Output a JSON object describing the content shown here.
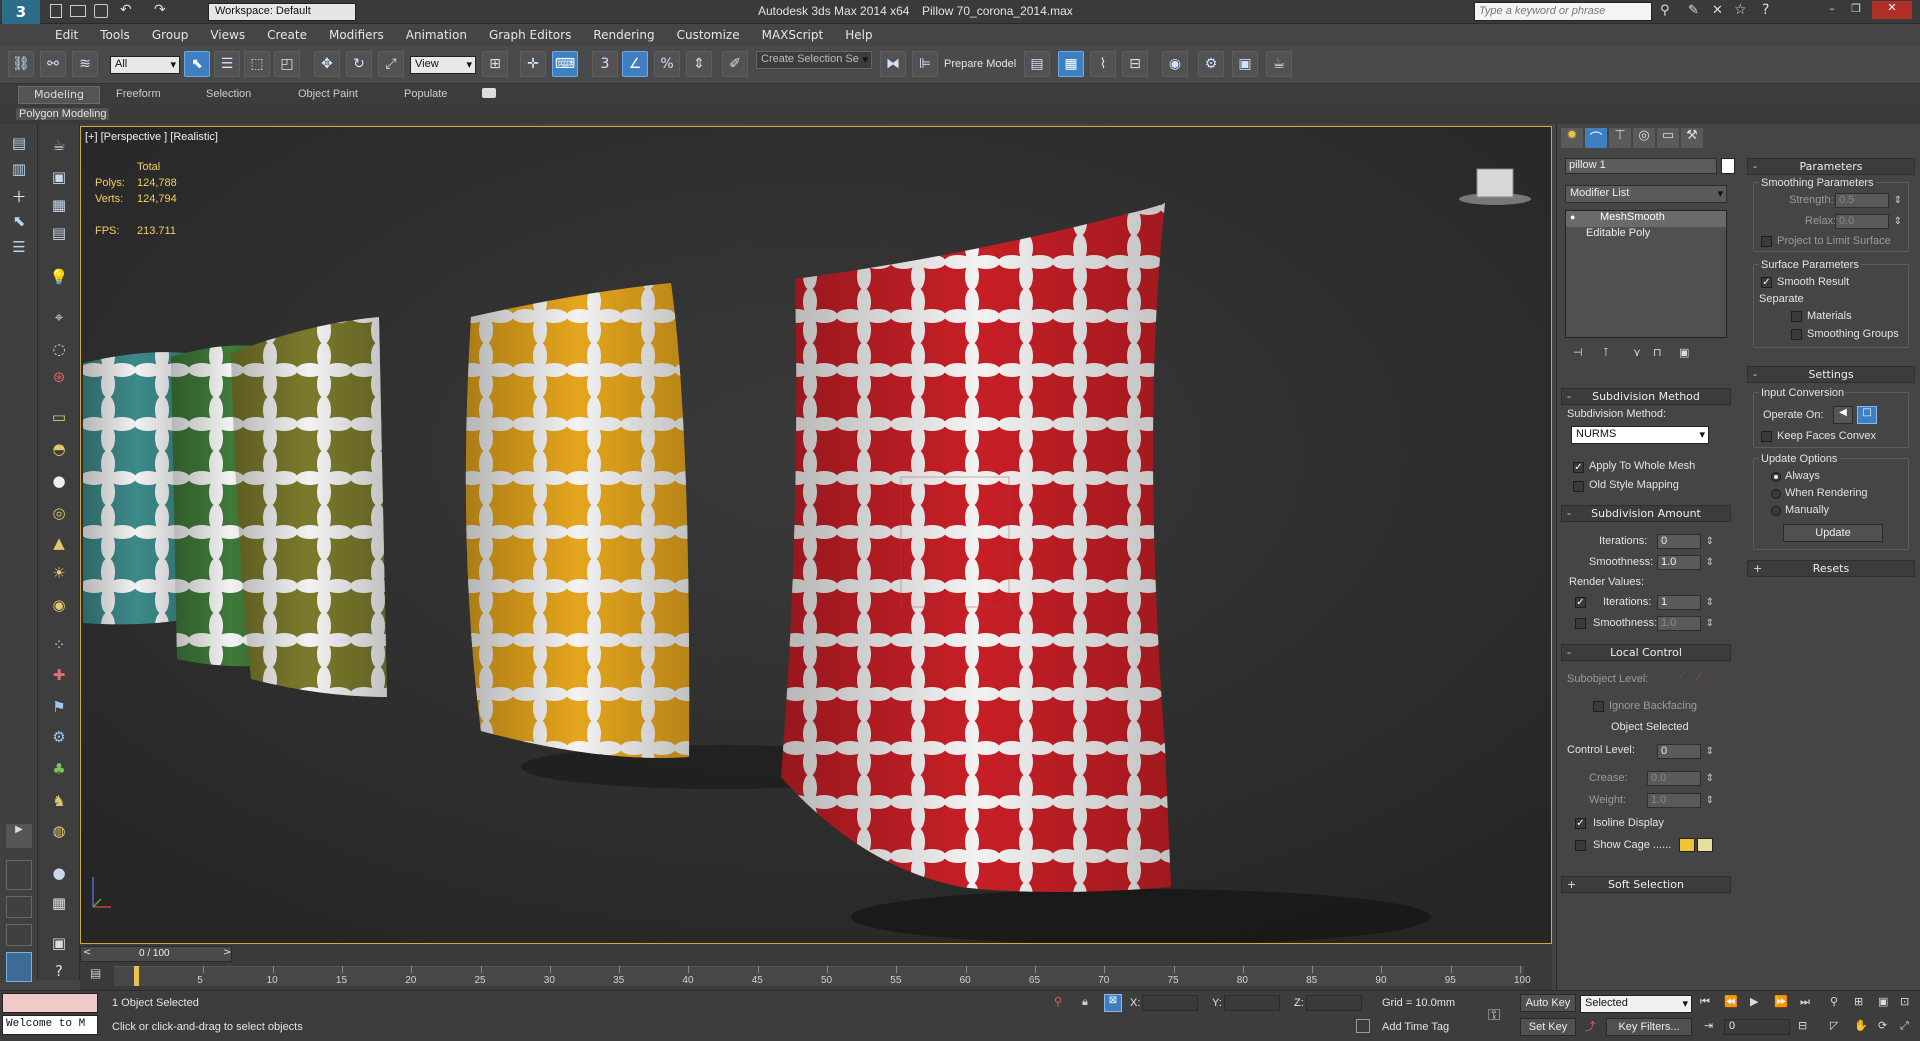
{
  "titlebar": {
    "workspace": "Workspace: Default",
    "app_title": "Autodesk 3ds Max  2014 x64",
    "file_name": "Pillow 70_corona_2014.max",
    "search_placeholder": "Type a keyword or phrase"
  },
  "menu": [
    "Edit",
    "Tools",
    "Group",
    "Views",
    "Create",
    "Modifiers",
    "Animation",
    "Graph Editors",
    "Rendering",
    "Customize",
    "MAXScript",
    "Help"
  ],
  "toolbar": {
    "selection_filter": "All",
    "ref_coord": "View",
    "named_selection": "Create Selection Se",
    "prepare_model": "Prepare Model"
  },
  "ribbon": {
    "tabs": [
      "Modeling",
      "Freeform",
      "Selection",
      "Object Paint",
      "Populate"
    ],
    "active_tab": "Modeling",
    "panel_label": "Polygon Modeling"
  },
  "viewport": {
    "label": "[+] [Perspective ] [Realistic]",
    "stats_header": "Total",
    "polys_label": "Polys:",
    "polys_value": "124,788",
    "verts_label": "Verts:",
    "verts_value": "124,794",
    "fps_label": "FPS:",
    "fps_value": "213.711",
    "pillow_colors": [
      "#3d8a8a",
      "#3f7a3a",
      "#7b7a2c",
      "#e5a51d",
      "#c81f26"
    ]
  },
  "command_panel": {
    "object_name": "pillow 1",
    "modifier_list": "Modifier List",
    "stack": [
      "MeshSmooth",
      "Editable Poly"
    ],
    "subdivision_method": {
      "title": "Subdivision Method",
      "label": "Subdivision Method:",
      "value": "NURMS",
      "apply_whole_mesh": "Apply To Whole Mesh",
      "old_style_mapping": "Old Style Mapping"
    },
    "subdivision_amount": {
      "title": "Subdivision Amount",
      "iterations_label": "Iterations:",
      "iterations_value": "0",
      "smoothness_label": "Smoothness:",
      "smoothness_value": "1.0",
      "render_values": "Render Values:",
      "render_iterations_label": "Iterations:",
      "render_iterations_value": "1",
      "render_smoothness_label": "Smoothness:",
      "render_smoothness_value": "1.0"
    },
    "local_control": {
      "title": "Local Control",
      "subobject_level": "Subobject Level:",
      "ignore_backfacing": "Ignore Backfacing",
      "object_selected": "Object Selected",
      "control_level_label": "Control Level:",
      "control_level_value": "0",
      "crease_label": "Crease:",
      "crease_value": "0.0",
      "weight_label": "Weight:",
      "weight_value": "1.0",
      "isoline_display": "Isoline Display",
      "show_cage": "Show Cage ......",
      "cage_color_1": "#f1c232",
      "cage_color_2": "#e8e09a"
    },
    "soft_selection": "Soft Selection",
    "parameters": {
      "title": "Parameters",
      "smoothing_params": "Smoothing Parameters",
      "strength_label": "Strength:",
      "strength_value": "0.5",
      "relax_label": "Relax:",
      "relax_value": "0.0",
      "project_limit": "Project to Limit Surface",
      "surface_params": "Surface Parameters",
      "smooth_result": "Smooth Result",
      "separate": "Separate",
      "materials": "Materials",
      "smoothing_groups": "Smoothing Groups"
    },
    "settings": {
      "title": "Settings",
      "input_conversion": "Input Conversion",
      "operate_on": "Operate On:",
      "keep_faces_convex": "Keep Faces Convex",
      "update_options": "Update Options",
      "always": "Always",
      "when_rendering": "When Rendering",
      "manually": "Manually",
      "update_button": "Update"
    },
    "resets": "Resets"
  },
  "timeline": {
    "slider_label": "0 / 100",
    "ticks": [
      "5",
      "10",
      "15",
      "20",
      "25",
      "30",
      "35",
      "40",
      "45",
      "50",
      "55",
      "60",
      "65",
      "70",
      "75",
      "80",
      "85",
      "90",
      "95",
      "100"
    ]
  },
  "status": {
    "listener": "Welcome to M",
    "selected": "1 Object Selected",
    "prompt": "Click or click-and-drag to select objects",
    "x_label": "X:",
    "y_label": "Y:",
    "z_label": "Z:",
    "grid": "Grid = 10.0mm",
    "add_time_tag": "Add Time Tag",
    "auto_key": "Auto Key",
    "set_key": "Set Key",
    "key_mode": "Selected",
    "key_filters": "Key Filters...",
    "frame": "0"
  }
}
